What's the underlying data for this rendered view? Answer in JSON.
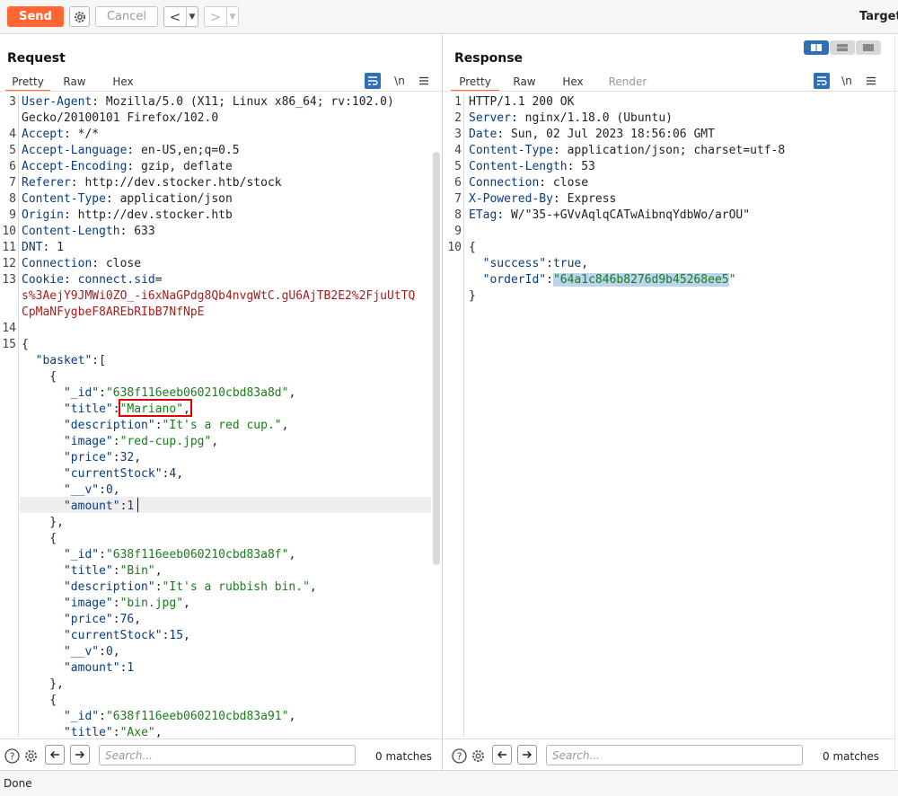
{
  "toolbar": {
    "send": "Send",
    "cancel": "Cancel",
    "target": "Target:"
  },
  "request": {
    "title": "Request",
    "tabs": [
      "Pretty",
      "Raw",
      "Hex"
    ],
    "search_placeholder": "Search...",
    "matches": "0 matches",
    "lines": [
      {
        "n": "3",
        "parts": [
          [
            "k",
            "User-Agent"
          ],
          [
            "p",
            ": Mozilla/5.0 (X11; Linux x86_64; rv:102.0)"
          ]
        ]
      },
      {
        "n": "",
        "parts": [
          [
            "p",
            "Gecko/20100101 Firefox/102.0"
          ]
        ]
      },
      {
        "n": "4",
        "parts": [
          [
            "k",
            "Accept"
          ],
          [
            "p",
            ": */*"
          ]
        ]
      },
      {
        "n": "5",
        "parts": [
          [
            "k",
            "Accept-Language"
          ],
          [
            "p",
            ": en-US,en;q=0.5"
          ]
        ]
      },
      {
        "n": "6",
        "parts": [
          [
            "k",
            "Accept-Encoding"
          ],
          [
            "p",
            ": gzip, deflate"
          ]
        ]
      },
      {
        "n": "7",
        "parts": [
          [
            "k",
            "Referer"
          ],
          [
            "p",
            ": http://dev.stocker.htb/stock"
          ]
        ]
      },
      {
        "n": "8",
        "parts": [
          [
            "k",
            "Content-Type"
          ],
          [
            "p",
            ": application/json"
          ]
        ]
      },
      {
        "n": "9",
        "parts": [
          [
            "k",
            "Origin"
          ],
          [
            "p",
            ": http://dev.stocker.htb"
          ]
        ]
      },
      {
        "n": "10",
        "parts": [
          [
            "k",
            "Content-Length"
          ],
          [
            "p",
            ": 633"
          ]
        ]
      },
      {
        "n": "11",
        "parts": [
          [
            "k",
            "DNT"
          ],
          [
            "p",
            ": 1"
          ]
        ]
      },
      {
        "n": "12",
        "parts": [
          [
            "k",
            "Connection"
          ],
          [
            "p",
            ": close"
          ]
        ]
      },
      {
        "n": "13",
        "parts": [
          [
            "k",
            "Cookie"
          ],
          [
            "p",
            ": "
          ],
          [
            "ck",
            "connect.sid"
          ],
          [
            "p",
            "="
          ]
        ]
      },
      {
        "n": "",
        "parts": [
          [
            "rd",
            "s%3AejY9JMWi0ZO_-i6xNaGPdg8Qb4nvgWtC.gU6AjTB2E2%2FjuUtTQ"
          ]
        ]
      },
      {
        "n": "",
        "parts": [
          [
            "rd",
            "CpMaNFygbeF8AREbRIbB7NfNpE"
          ]
        ]
      },
      {
        "n": "14",
        "parts": []
      },
      {
        "n": "15",
        "parts": [
          [
            "p",
            "{"
          ]
        ]
      },
      {
        "n": "",
        "parts": [
          [
            "p",
            "  "
          ],
          [
            "k",
            "\"basket\""
          ],
          [
            "p",
            ":["
          ]
        ]
      },
      {
        "n": "",
        "parts": [
          [
            "p",
            "    {"
          ]
        ]
      },
      {
        "n": "",
        "parts": [
          [
            "p",
            "      "
          ],
          [
            "k",
            "\"_id\""
          ],
          [
            "p",
            ":"
          ],
          [
            "s",
            "\"638f116eeb060210cbd83a8d\""
          ],
          [
            "p",
            ","
          ]
        ]
      },
      {
        "n": "",
        "parts": [
          [
            "p",
            "      "
          ],
          [
            "k",
            "\"title\""
          ],
          [
            "p",
            ":"
          ],
          [
            "s",
            "\"Mariano\""
          ],
          [
            "p",
            ","
          ]
        ]
      },
      {
        "n": "",
        "parts": [
          [
            "p",
            "      "
          ],
          [
            "k",
            "\"description\""
          ],
          [
            "p",
            ":"
          ],
          [
            "s",
            "\"It's a red cup.\""
          ],
          [
            "p",
            ","
          ]
        ]
      },
      {
        "n": "",
        "parts": [
          [
            "p",
            "      "
          ],
          [
            "k",
            "\"image\""
          ],
          [
            "p",
            ":"
          ],
          [
            "s",
            "\"red-cup.jpg\""
          ],
          [
            "p",
            ","
          ]
        ]
      },
      {
        "n": "",
        "parts": [
          [
            "p",
            "      "
          ],
          [
            "k",
            "\"price\""
          ],
          [
            "p",
            ":"
          ],
          [
            "k",
            "32"
          ],
          [
            "p",
            ","
          ]
        ]
      },
      {
        "n": "",
        "parts": [
          [
            "p",
            "      "
          ],
          [
            "k",
            "\"currentStock\""
          ],
          [
            "p",
            ":"
          ],
          [
            "k",
            "4"
          ],
          [
            "p",
            ","
          ]
        ]
      },
      {
        "n": "",
        "parts": [
          [
            "p",
            "      "
          ],
          [
            "k",
            "\"__v\""
          ],
          [
            "p",
            ":"
          ],
          [
            "k",
            "0"
          ],
          [
            "p",
            ","
          ]
        ]
      },
      {
        "n": "",
        "parts": [
          [
            "p",
            "      "
          ],
          [
            "k",
            "\"amount\""
          ],
          [
            "p",
            ":"
          ],
          [
            "k",
            "1"
          ]
        ]
      },
      {
        "n": "",
        "parts": [
          [
            "p",
            "    },"
          ]
        ]
      },
      {
        "n": "",
        "parts": [
          [
            "p",
            "    {"
          ]
        ]
      },
      {
        "n": "",
        "parts": [
          [
            "p",
            "      "
          ],
          [
            "k",
            "\"_id\""
          ],
          [
            "p",
            ":"
          ],
          [
            "s",
            "\"638f116eeb060210cbd83a8f\""
          ],
          [
            "p",
            ","
          ]
        ]
      },
      {
        "n": "",
        "parts": [
          [
            "p",
            "      "
          ],
          [
            "k",
            "\"title\""
          ],
          [
            "p",
            ":"
          ],
          [
            "s",
            "\"Bin\""
          ],
          [
            "p",
            ","
          ]
        ]
      },
      {
        "n": "",
        "parts": [
          [
            "p",
            "      "
          ],
          [
            "k",
            "\"description\""
          ],
          [
            "p",
            ":"
          ],
          [
            "s",
            "\"It's a rubbish bin.\""
          ],
          [
            "p",
            ","
          ]
        ]
      },
      {
        "n": "",
        "parts": [
          [
            "p",
            "      "
          ],
          [
            "k",
            "\"image\""
          ],
          [
            "p",
            ":"
          ],
          [
            "s",
            "\"bin.jpg\""
          ],
          [
            "p",
            ","
          ]
        ]
      },
      {
        "n": "",
        "parts": [
          [
            "p",
            "      "
          ],
          [
            "k",
            "\"price\""
          ],
          [
            "p",
            ":"
          ],
          [
            "k",
            "76"
          ],
          [
            "p",
            ","
          ]
        ]
      },
      {
        "n": "",
        "parts": [
          [
            "p",
            "      "
          ],
          [
            "k",
            "\"currentStock\""
          ],
          [
            "p",
            ":"
          ],
          [
            "k",
            "15"
          ],
          [
            "p",
            ","
          ]
        ]
      },
      {
        "n": "",
        "parts": [
          [
            "p",
            "      "
          ],
          [
            "k",
            "\"__v\""
          ],
          [
            "p",
            ":"
          ],
          [
            "k",
            "0"
          ],
          [
            "p",
            ","
          ]
        ]
      },
      {
        "n": "",
        "parts": [
          [
            "p",
            "      "
          ],
          [
            "k",
            "\"amount\""
          ],
          [
            "p",
            ":"
          ],
          [
            "k",
            "1"
          ]
        ]
      },
      {
        "n": "",
        "parts": [
          [
            "p",
            "    },"
          ]
        ]
      },
      {
        "n": "",
        "parts": [
          [
            "p",
            "    {"
          ]
        ]
      },
      {
        "n": "",
        "parts": [
          [
            "p",
            "      "
          ],
          [
            "k",
            "\"_id\""
          ],
          [
            "p",
            ":"
          ],
          [
            "s",
            "\"638f116eeb060210cbd83a91\""
          ],
          [
            "p",
            ","
          ]
        ]
      },
      {
        "n": "",
        "parts": [
          [
            "p",
            "      "
          ],
          [
            "k",
            "\"title\""
          ],
          [
            "p",
            ":"
          ],
          [
            "s",
            "\"Axe\""
          ],
          [
            "p",
            ","
          ]
        ]
      }
    ]
  },
  "response": {
    "title": "Response",
    "tabs": [
      "Pretty",
      "Raw",
      "Hex",
      "Render"
    ],
    "search_placeholder": "Search...",
    "matches": "0 matches",
    "lines": [
      {
        "n": "1",
        "parts": [
          [
            "p",
            "HTTP/1.1 200 OK"
          ]
        ]
      },
      {
        "n": "2",
        "parts": [
          [
            "k",
            "Server"
          ],
          [
            "p",
            ": nginx/1.18.0 (Ubuntu)"
          ]
        ]
      },
      {
        "n": "3",
        "parts": [
          [
            "k",
            "Date"
          ],
          [
            "p",
            ": Sun, 02 Jul 2023 18:56:06 GMT"
          ]
        ]
      },
      {
        "n": "4",
        "parts": [
          [
            "k",
            "Content-Type"
          ],
          [
            "p",
            ": application/json; charset=utf-8"
          ]
        ]
      },
      {
        "n": "5",
        "parts": [
          [
            "k",
            "Content-Length"
          ],
          [
            "p",
            ": 53"
          ]
        ]
      },
      {
        "n": "6",
        "parts": [
          [
            "k",
            "Connection"
          ],
          [
            "p",
            ": close"
          ]
        ]
      },
      {
        "n": "7",
        "parts": [
          [
            "k",
            "X-Powered-By"
          ],
          [
            "p",
            ": Express"
          ]
        ]
      },
      {
        "n": "8",
        "parts": [
          [
            "k",
            "ETag"
          ],
          [
            "p",
            ": W/\"35-+GVvAqlqCATwAibnqYdbWo/arOU\""
          ]
        ]
      },
      {
        "n": "9",
        "parts": []
      },
      {
        "n": "10",
        "parts": [
          [
            "p",
            "{"
          ]
        ]
      },
      {
        "n": "",
        "parts": [
          [
            "p",
            "  "
          ],
          [
            "k",
            "\"success\""
          ],
          [
            "p",
            ":"
          ],
          [
            "k",
            "true"
          ],
          [
            "p",
            ","
          ]
        ]
      },
      {
        "n": "",
        "parts": [
          [
            "p",
            "  "
          ],
          [
            "k",
            "\"orderId\""
          ],
          [
            "p",
            ":"
          ],
          [
            "sel",
            "\"64a1c846b8276d9b45268ee5"
          ],
          [
            "s",
            "\""
          ]
        ]
      },
      {
        "n": "",
        "parts": [
          [
            "p",
            "}"
          ]
        ]
      }
    ]
  },
  "status": {
    "text": "Done"
  },
  "colors": {
    "accent": "#ff6633",
    "key": "#0a3c7d",
    "string": "#1a7c1a",
    "cookie_value": "#a71d1d",
    "toggle_active": "#2f6fb5"
  }
}
